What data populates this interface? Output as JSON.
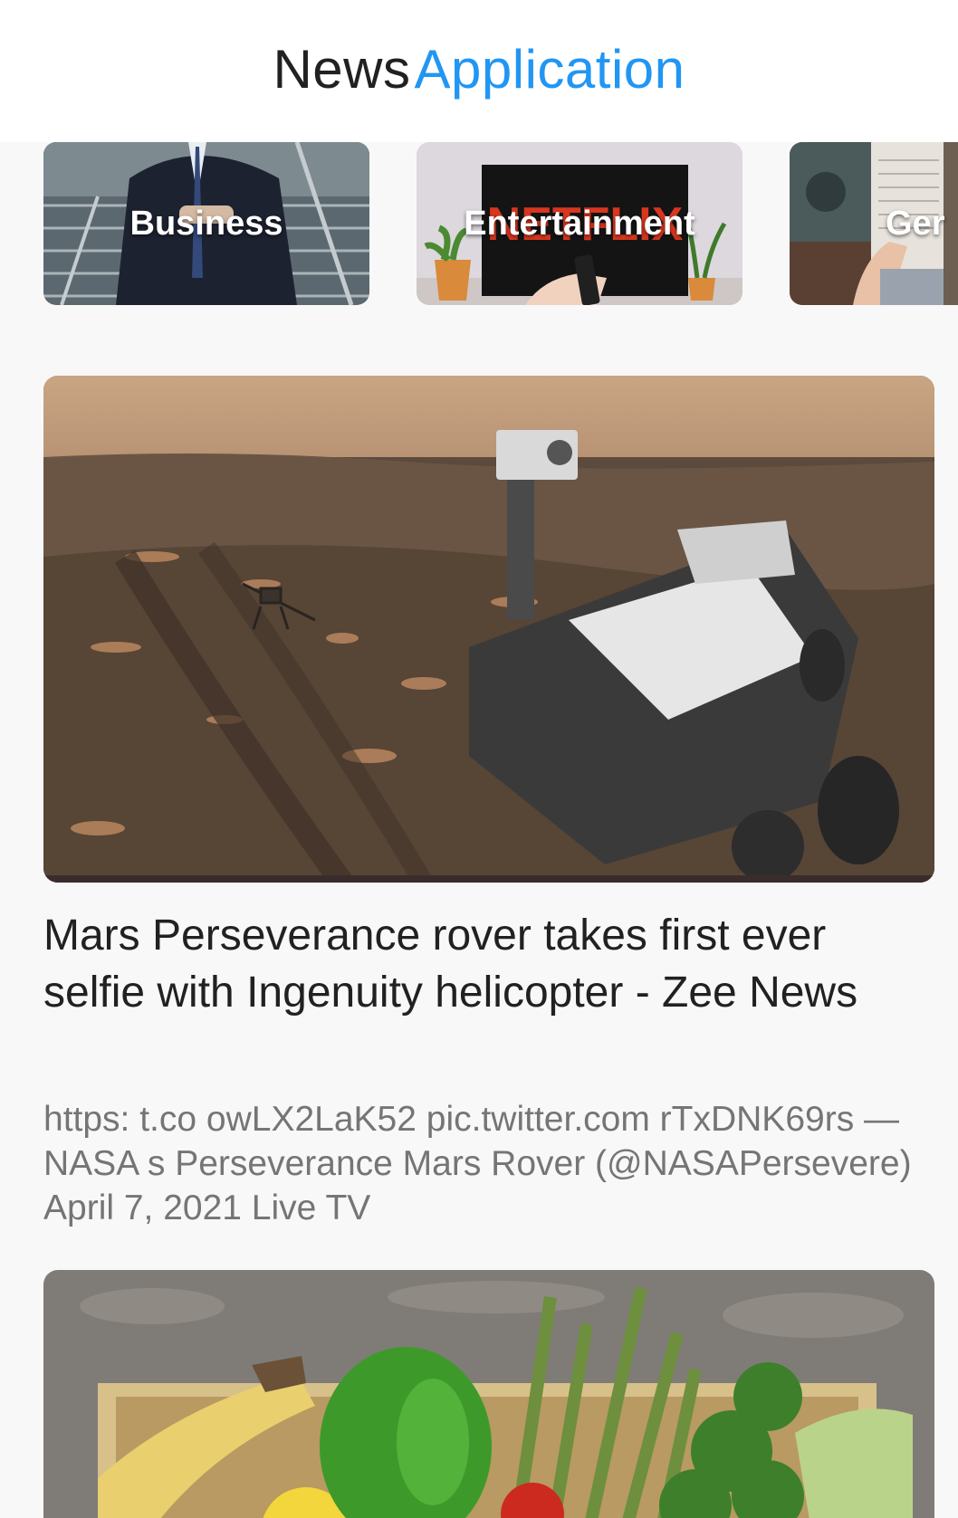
{
  "app_bar": {
    "title_part1": "News",
    "title_part2": "Application",
    "accent_color": "#2196f3"
  },
  "categories": [
    {
      "label": "Business",
      "image": "businessman-on-stairs"
    },
    {
      "label": "Entertainment",
      "image": "tv-netflix-remote",
      "tv_text": "NETFLIX"
    },
    {
      "label": "Ger",
      "image": "person-reading-newspaper"
    }
  ],
  "articles": [
    {
      "image": "mars-rover-selfie-with-helicopter",
      "title": "Mars Perseverance rover takes first ever selfie with Ingenuity helicopter - Zee News",
      "description": "https:  t.co owLX2LaK52 pic.twitter.com rTxDNK69rs — NASA s Perseverance Mars Rover (@NASAPersevere) April 7, 2021 Live TV"
    },
    {
      "image": "fresh-vegetables-in-crate"
    }
  ]
}
